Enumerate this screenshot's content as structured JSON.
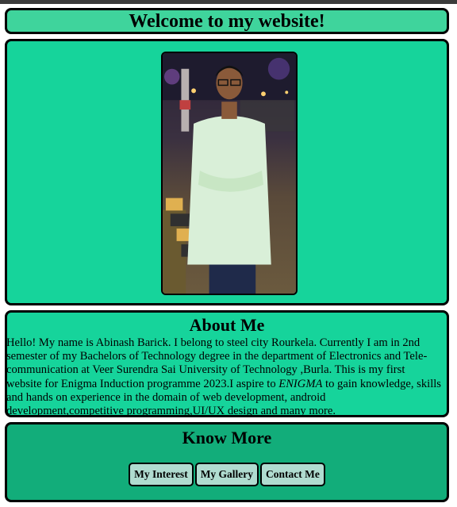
{
  "header": {
    "title": "Welcome to my website!"
  },
  "about": {
    "heading": "About Me",
    "text_before": "Hello! My name is Abinash Barick. I belong to steel city Rourkela. Currently I am in 2nd semester of my Bachelors of Technology degree in the department of Electronics and Tele-communication at Veer Surendra Sai University of Technology ,Burla. This is my first website for Enigma Induction programme 2023.I aspire to ",
    "emphasis": "ENIGMA",
    "text_after": " to gain knowledge, skills and hands on experience in the domain of web development, android development,competitive programming,UI/UX design and many more."
  },
  "know_more": {
    "heading": "Know More",
    "buttons": [
      "My Interest",
      "My Gallery",
      "Contact Me"
    ]
  },
  "colors": {
    "header_bg": "#3fd49c",
    "section_bg": "#16d49b",
    "footer_bg": "#12ad7a",
    "button_bg": "#b0dcd0"
  }
}
